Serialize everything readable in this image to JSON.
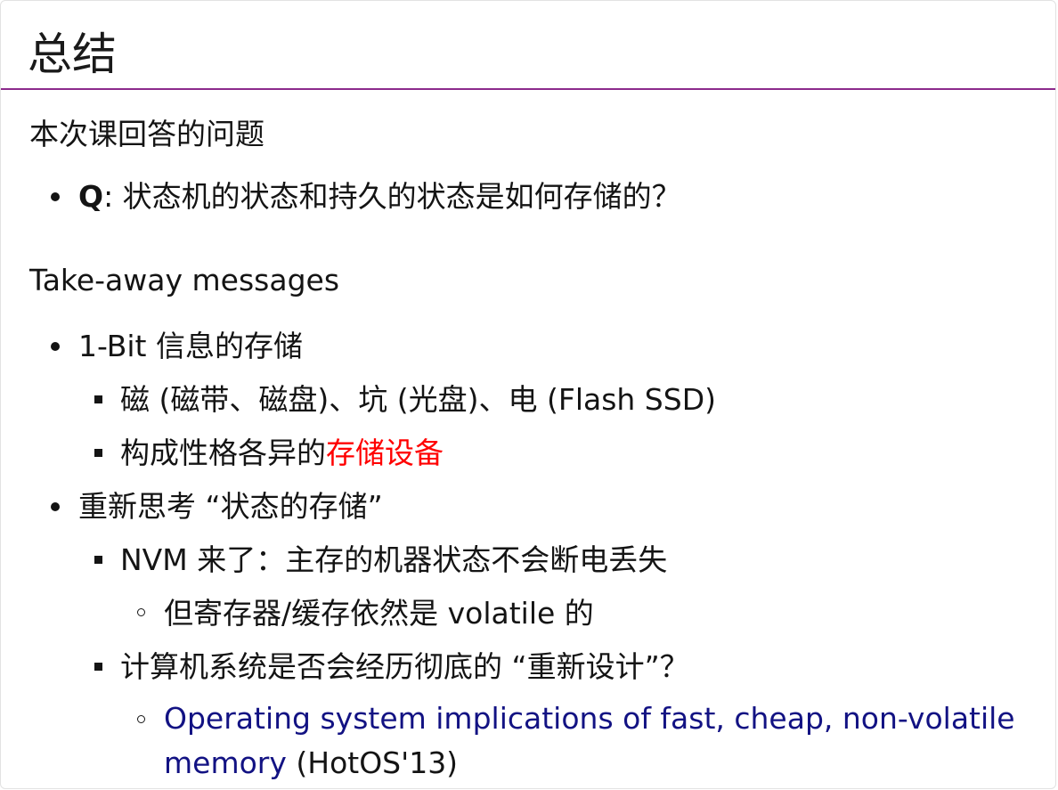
{
  "slide": {
    "title": "总结",
    "section1_heading": "本次课回答的问题",
    "q_label": "Q",
    "q_text": ": 状态机的状态和持久的状态是如何存储的？",
    "section2_heading": "Take-away messages",
    "bullet_1": "1-Bit 信息的存储",
    "bullet_1_1": "磁 (磁带、磁盘)、坑 (光盘)、电 (Flash SSD)",
    "bullet_1_2_prefix": "构成性格各异的",
    "bullet_1_2_highlight": "存储设备",
    "bullet_2": "重新思考 “状态的存储”",
    "bullet_2_1": "NVM 来了：主存的机器状态不会断电丢失",
    "bullet_2_1_1": "但寄存器/缓存依然是 volatile 的",
    "bullet_2_2": "计算机系统是否会经历彻底的 “重新设计”？",
    "paper_link_line1": "Operating system implications of fast, cheap, non-volatile",
    "paper_link_line2": "memory",
    "paper_venue": " (HotOS'13)"
  },
  "colors": {
    "title_rule": "#8c2a8c",
    "highlight": "#ff0000",
    "link": "#121283",
    "text": "#141414"
  }
}
